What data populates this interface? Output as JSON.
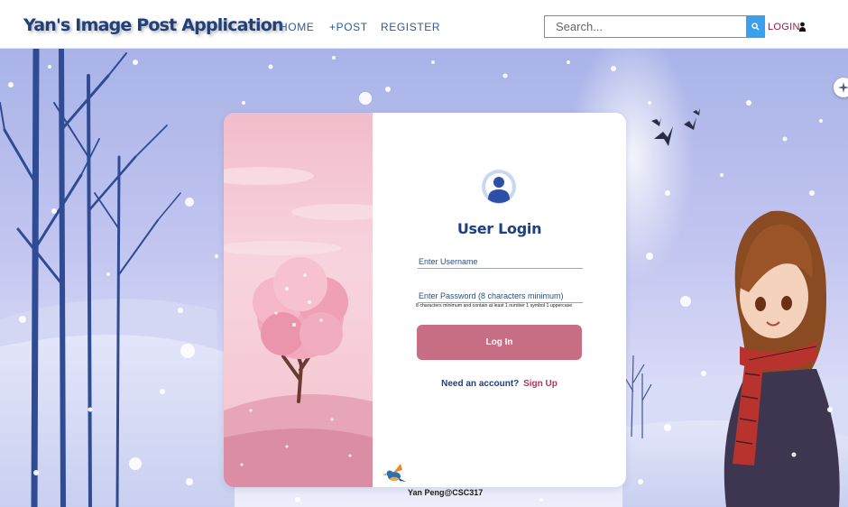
{
  "navbar": {
    "brand": "Yan's Image Post Application",
    "links": [
      {
        "label": "HOME"
      },
      {
        "label": "+POST"
      },
      {
        "label": "REGISTER"
      }
    ],
    "search": {
      "placeholder": "Search...",
      "value": ""
    },
    "login_label": "LOGIN"
  },
  "login_form": {
    "title": "User Login",
    "username": {
      "placeholder": "Enter Username",
      "value": ""
    },
    "password": {
      "placeholder": "Enter Password (8 characters minimum)",
      "value": ""
    },
    "password_hint": "8 characters minimum and contain at least 1 number 1 symbol 1 uppercase",
    "submit_label": "Log In",
    "signup_prompt": "Need an account?",
    "signup_link": "Sign Up"
  },
  "footer": {
    "credit": "Yan Peng@CSC317"
  },
  "icons": {
    "search": "search-icon",
    "user": "user-icon",
    "avatar": "user-avatar-icon",
    "fab": "sparkle-icon",
    "bird": "bird-icon"
  },
  "colors": {
    "brand": "#1f3f7d",
    "nav_link": "#2d5a96",
    "search_accent": "#3aa0ee",
    "login_link": "#8b1d4a",
    "button": "#c76d84",
    "signup_link": "#b8335e"
  }
}
